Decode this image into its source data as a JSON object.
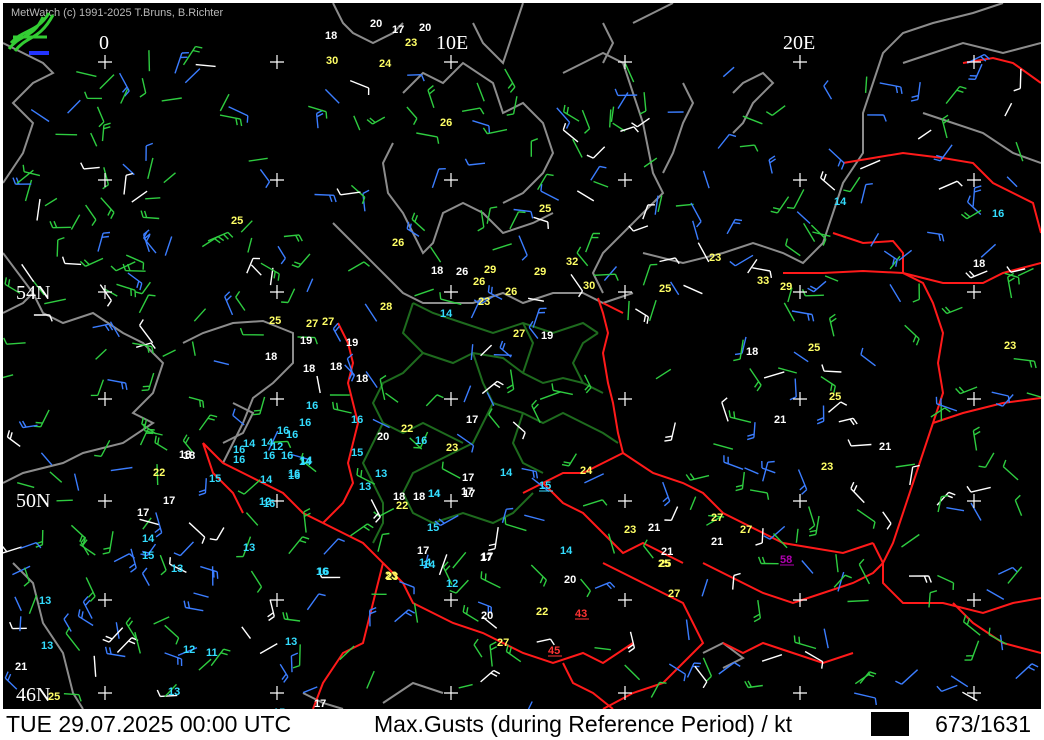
{
  "app": {
    "copyright": "MetWatch  (c) 1991-2025 T.Bruns, B.Richter"
  },
  "map": {
    "grid_labels": {
      "lon_0": "0",
      "lon_10": "10E",
      "lon_20": "20E",
      "lat_54": "54N",
      "lat_50": "50N",
      "lat_46": "46N"
    },
    "colors": {
      "background": "#000000",
      "coast": "#8c8c8c",
      "border_red": "#ff1a1a",
      "border_green": "#1e6b1e",
      "value_white": "#ffffff",
      "value_yellow": "#ffff66",
      "value_cyan": "#33ddff",
      "value_red": "#ff3333",
      "value_purple": "#b000b0"
    }
  },
  "status": {
    "datetime": "TUE 29.07.2025 00:00 UTC",
    "title": "Max.Gusts (during Reference Period) / kt",
    "count": "673/1631"
  },
  "stations": [
    {
      "v": "18",
      "c": "white"
    },
    {
      "v": "20",
      "c": "white"
    },
    {
      "v": "17",
      "c": "white"
    },
    {
      "v": "20",
      "c": "white"
    },
    {
      "v": "30",
      "c": "yellow"
    },
    {
      "v": "24",
      "c": "yellow"
    },
    {
      "v": "23",
      "c": "yellow"
    },
    {
      "v": "26",
      "c": "yellow"
    },
    {
      "v": "25",
      "c": "yellow"
    },
    {
      "v": "25",
      "c": "yellow"
    },
    {
      "v": "26",
      "c": "yellow"
    },
    {
      "v": "18",
      "c": "white"
    },
    {
      "v": "26",
      "c": "white"
    },
    {
      "v": "29",
      "c": "yellow"
    },
    {
      "v": "26",
      "c": "yellow"
    },
    {
      "v": "29",
      "c": "yellow"
    },
    {
      "v": "32",
      "c": "yellow"
    },
    {
      "v": "30",
      "c": "yellow"
    },
    {
      "v": "26",
      "c": "yellow"
    },
    {
      "v": "23",
      "c": "yellow"
    },
    {
      "v": "27",
      "c": "yellow"
    },
    {
      "v": "28",
      "c": "yellow"
    },
    {
      "v": "25",
      "c": "yellow"
    },
    {
      "v": "27",
      "c": "yellow"
    },
    {
      "v": "27",
      "c": "yellow"
    },
    {
      "v": "19",
      "c": "white"
    },
    {
      "v": "19",
      "c": "white"
    },
    {
      "v": "18",
      "c": "white"
    },
    {
      "v": "18",
      "c": "white"
    },
    {
      "v": "18",
      "c": "white"
    },
    {
      "v": "18",
      "c": "white"
    },
    {
      "v": "14",
      "c": "cyan"
    },
    {
      "v": "19",
      "c": "white"
    },
    {
      "v": "14",
      "c": "cyan"
    },
    {
      "v": "16",
      "c": "cyan"
    },
    {
      "v": "23",
      "c": "yellow"
    },
    {
      "v": "33",
      "c": "yellow"
    },
    {
      "v": "29",
      "c": "yellow"
    },
    {
      "v": "25",
      "c": "yellow"
    },
    {
      "v": "18",
      "c": "white"
    },
    {
      "v": "16",
      "c": "cyan"
    },
    {
      "v": "18",
      "c": "white"
    },
    {
      "v": "23",
      "c": "yellow"
    },
    {
      "v": "25",
      "c": "yellow"
    },
    {
      "v": "25",
      "c": "yellow"
    },
    {
      "v": "18",
      "c": "white"
    },
    {
      "v": "21",
      "c": "white"
    },
    {
      "v": "21",
      "c": "white"
    },
    {
      "v": "16",
      "c": "cyan"
    },
    {
      "v": "16",
      "c": "cyan"
    },
    {
      "v": "15",
      "c": "cyan"
    },
    {
      "v": "16",
      "c": "cyan"
    },
    {
      "v": "16",
      "c": "cyan"
    },
    {
      "v": "22",
      "c": "yellow"
    },
    {
      "v": "20",
      "c": "white"
    },
    {
      "v": "16",
      "c": "cyan"
    },
    {
      "v": "23",
      "c": "yellow"
    },
    {
      "v": "17",
      "c": "white"
    },
    {
      "v": "14",
      "c": "cyan"
    },
    {
      "v": "14",
      "c": "cyan"
    },
    {
      "v": "16",
      "c": "cyan"
    },
    {
      "v": "16",
      "c": "cyan"
    },
    {
      "v": "12",
      "c": "cyan"
    },
    {
      "v": "14",
      "c": "cyan"
    },
    {
      "v": "18",
      "c": "white"
    },
    {
      "v": "16",
      "c": "cyan"
    },
    {
      "v": "16",
      "c": "cyan"
    },
    {
      "v": "16",
      "c": "cyan"
    },
    {
      "v": "14",
      "c": "cyan"
    },
    {
      "v": "22",
      "c": "yellow"
    },
    {
      "v": "15",
      "c": "cyan"
    },
    {
      "v": "14",
      "c": "cyan"
    },
    {
      "v": "16",
      "c": "cyan"
    },
    {
      "v": "13",
      "c": "cyan"
    },
    {
      "v": "13",
      "c": "cyan"
    },
    {
      "v": "12",
      "c": "cyan"
    },
    {
      "v": "17",
      "c": "white"
    },
    {
      "v": "17",
      "c": "white"
    },
    {
      "v": "18",
      "c": "white"
    },
    {
      "v": "22",
      "c": "yellow"
    },
    {
      "v": "14",
      "c": "cyan"
    },
    {
      "v": "17",
      "c": "white"
    },
    {
      "v": "14",
      "c": "cyan"
    },
    {
      "v": "24",
      "c": "yellow"
    },
    {
      "v": "15",
      "c": "cyan"
    },
    {
      "v": "23",
      "c": "yellow"
    },
    {
      "v": "17",
      "c": "white"
    },
    {
      "v": "17",
      "c": "white"
    },
    {
      "v": "14",
      "c": "cyan"
    },
    {
      "v": "15",
      "c": "cyan"
    },
    {
      "v": "23",
      "c": "yellow"
    },
    {
      "v": "21",
      "c": "white"
    },
    {
      "v": "27",
      "c": "yellow"
    },
    {
      "v": "27",
      "c": "yellow"
    },
    {
      "v": "21",
      "c": "white"
    },
    {
      "v": "21",
      "c": "white"
    },
    {
      "v": "25",
      "c": "yellow"
    },
    {
      "v": "58",
      "c": "purple"
    },
    {
      "v": "13",
      "c": "cyan"
    },
    {
      "v": "17",
      "c": "white"
    },
    {
      "v": "14",
      "c": "cyan"
    },
    {
      "v": "15",
      "c": "cyan"
    },
    {
      "v": "13",
      "c": "cyan"
    },
    {
      "v": "16",
      "c": "cyan"
    },
    {
      "v": "14",
      "c": "cyan"
    },
    {
      "v": "17",
      "c": "white"
    },
    {
      "v": "23",
      "c": "yellow"
    },
    {
      "v": "12",
      "c": "cyan"
    },
    {
      "v": "17",
      "c": "white"
    },
    {
      "v": "14",
      "c": "cyan"
    },
    {
      "v": "20",
      "c": "white"
    },
    {
      "v": "20",
      "c": "white"
    },
    {
      "v": "22",
      "c": "yellow"
    },
    {
      "v": "43",
      "c": "red"
    },
    {
      "v": "27",
      "c": "yellow"
    },
    {
      "v": "27",
      "c": "yellow"
    },
    {
      "v": "45",
      "c": "red"
    },
    {
      "v": "13",
      "c": "cyan"
    },
    {
      "v": "13",
      "c": "cyan"
    },
    {
      "v": "12",
      "c": "cyan"
    },
    {
      "v": "11",
      "c": "cyan"
    },
    {
      "v": "13",
      "c": "cyan"
    },
    {
      "v": "21",
      "c": "white"
    },
    {
      "v": "25",
      "c": "yellow"
    },
    {
      "v": "13",
      "c": "cyan"
    },
    {
      "v": "15",
      "c": "cyan"
    },
    {
      "v": "17",
      "c": "white"
    },
    {
      "v": "14",
      "c": "cyan"
    },
    {
      "v": "16",
      "c": "cyan"
    },
    {
      "v": "23",
      "c": "yellow"
    },
    {
      "v": "18",
      "c": "white"
    },
    {
      "v": "25",
      "c": "yellow"
    },
    {
      "v": "16",
      "c": "cyan"
    }
  ]
}
